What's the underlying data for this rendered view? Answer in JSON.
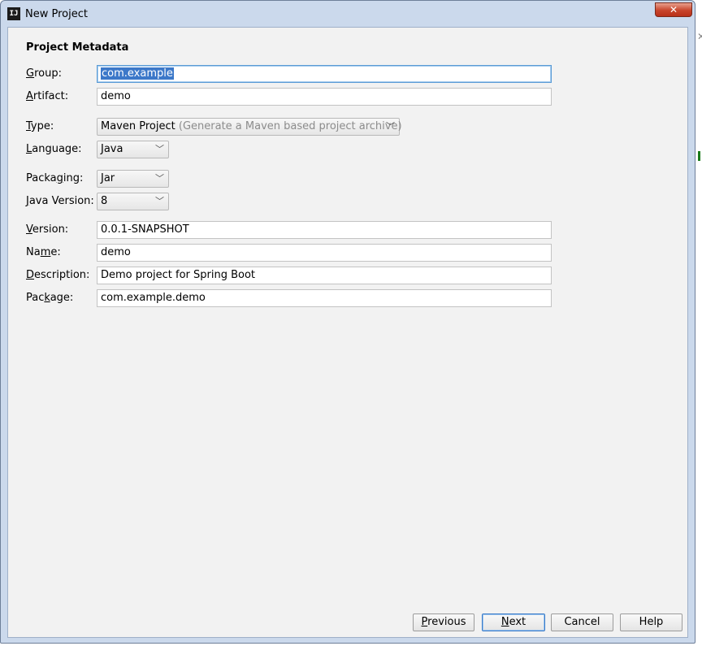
{
  "window": {
    "title": "New Project",
    "close_glyph": "✕",
    "app_icon": "IJ"
  },
  "section_title": "Project Metadata",
  "fields": {
    "group": {
      "label_pre": "",
      "label_mn": "G",
      "label_post": "roup:",
      "value": "com.example"
    },
    "artifact": {
      "label_pre": "",
      "label_mn": "A",
      "label_post": "rtifact:",
      "value": "demo"
    },
    "version": {
      "label_pre": "",
      "label_mn": "V",
      "label_post": "ersion:",
      "value": "0.0.1-SNAPSHOT"
    },
    "name": {
      "label_pre": "Na",
      "label_mn": "m",
      "label_post": "e:",
      "value": "demo"
    },
    "description": {
      "label_pre": "",
      "label_mn": "D",
      "label_post": "escription:",
      "value": "Demo project for Spring Boot"
    },
    "package": {
      "label_pre": "Pac",
      "label_mn": "k",
      "label_post": "age:",
      "value": "com.example.demo"
    }
  },
  "combos": {
    "type": {
      "label_pre": "",
      "label_mn": "T",
      "label_post": "ype:",
      "value": "Maven Project",
      "hint": "(Generate a Maven based project archive)"
    },
    "language": {
      "label_pre": "",
      "label_mn": "L",
      "label_post": "anguage:",
      "value": "Java"
    },
    "packaging": {
      "label_pre": "Packa",
      "label_mn": "g",
      "label_post": "ing:",
      "value": "Jar"
    },
    "java_version": {
      "label_pre": "",
      "label_mn": "J",
      "label_post": "ava Version:",
      "value": "8"
    }
  },
  "chevron_glyph": "﹀",
  "buttons": {
    "previous": {
      "mn": "P",
      "rest": "revious"
    },
    "next": {
      "mn": "N",
      "rest": "ext"
    },
    "cancel": {
      "mn": "",
      "rest": "Cancel"
    },
    "help": {
      "mn": "",
      "rest": "Help"
    }
  },
  "colors": {
    "selection": "#3c78c9",
    "focus_border": "#5a9bd5",
    "title_close": "#c8442b"
  }
}
